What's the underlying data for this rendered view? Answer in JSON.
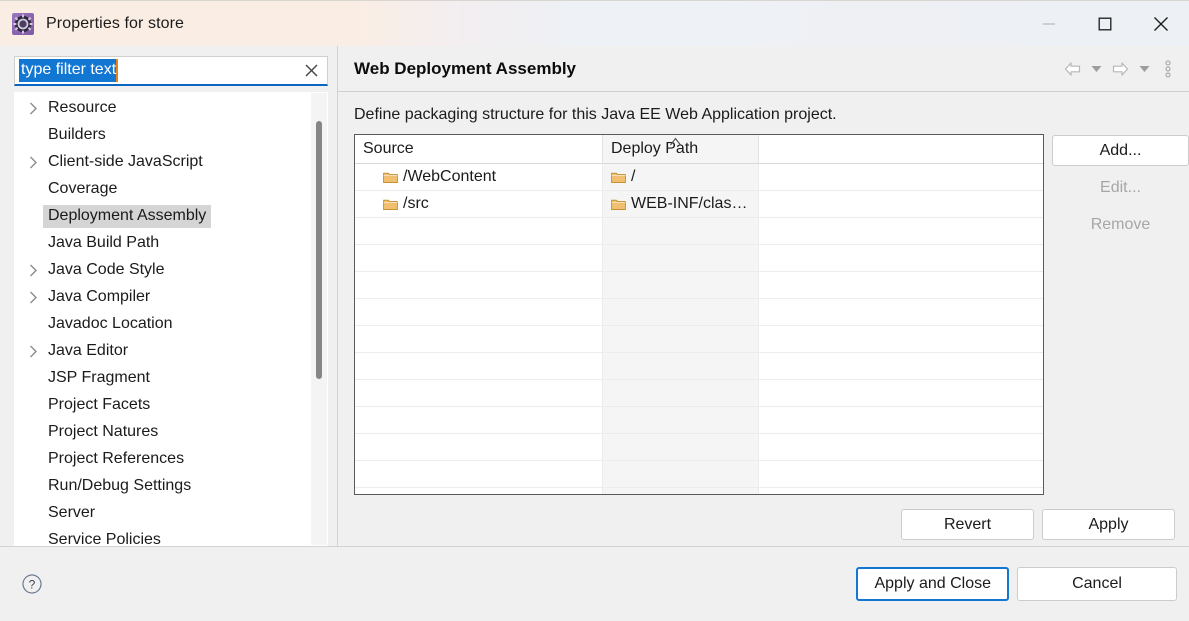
{
  "window": {
    "title": "Properties for store",
    "icon": "properties-gear-icon",
    "controls": {
      "minimize": "minimize-icon",
      "maximize": "maximize-icon",
      "close": "close-icon"
    }
  },
  "sidebar": {
    "filter": {
      "value": "type filter text",
      "placeholder": "type filter text",
      "clear_icon": "clear-icon",
      "selected": true
    },
    "items": [
      {
        "label": "Resource",
        "expandable": true,
        "selected": false
      },
      {
        "label": "Builders",
        "expandable": false,
        "selected": false
      },
      {
        "label": "Client-side JavaScript",
        "expandable": true,
        "selected": false
      },
      {
        "label": "Coverage",
        "expandable": false,
        "selected": false
      },
      {
        "label": "Deployment Assembly",
        "expandable": false,
        "selected": true
      },
      {
        "label": "Java Build Path",
        "expandable": false,
        "selected": false
      },
      {
        "label": "Java Code Style",
        "expandable": true,
        "selected": false
      },
      {
        "label": "Java Compiler",
        "expandable": true,
        "selected": false
      },
      {
        "label": "Javadoc Location",
        "expandable": false,
        "selected": false
      },
      {
        "label": "Java Editor",
        "expandable": true,
        "selected": false
      },
      {
        "label": "JSP Fragment",
        "expandable": false,
        "selected": false
      },
      {
        "label": "Project Facets",
        "expandable": false,
        "selected": false
      },
      {
        "label": "Project Natures",
        "expandable": false,
        "selected": false
      },
      {
        "label": "Project References",
        "expandable": false,
        "selected": false
      },
      {
        "label": "Run/Debug Settings",
        "expandable": false,
        "selected": false
      },
      {
        "label": "Server",
        "expandable": false,
        "selected": false
      },
      {
        "label": "Service Policies",
        "expandable": false,
        "selected": false
      }
    ]
  },
  "page": {
    "title": "Web Deployment Assembly",
    "description": "Define packaging structure for this Java EE Web Application project.",
    "nav": {
      "back_icon": "back-arrow-icon",
      "back_menu_icon": "chevron-down-icon",
      "forward_icon": "forward-arrow-icon",
      "forward_menu_icon": "chevron-down-icon",
      "overflow_icon": "vertical-dots-icon"
    }
  },
  "table": {
    "columns": [
      {
        "label": "Source",
        "sorted": false
      },
      {
        "label": "Deploy Path",
        "sorted": true,
        "sort_direction": "ascending"
      },
      {
        "label": "",
        "sorted": false
      }
    ],
    "rows": [
      {
        "source": "/WebContent",
        "deploy_path": "/",
        "source_icon": "folder-icon",
        "deploy_icon": "folder-icon"
      },
      {
        "source": "/src",
        "deploy_path": "WEB-INF/clas…",
        "source_icon": "folder-icon",
        "deploy_icon": "folder-icon"
      }
    ],
    "empty_row_count": 11
  },
  "side_buttons": [
    {
      "label": "Add...",
      "enabled": true
    },
    {
      "label": "Edit...",
      "enabled": false
    },
    {
      "label": "Remove",
      "enabled": false
    }
  ],
  "apply_buttons": [
    {
      "label": "Revert",
      "enabled": true
    },
    {
      "label": "Apply",
      "enabled": true
    }
  ],
  "footer": {
    "help_icon": "help-icon",
    "buttons": [
      {
        "label": "Apply and Close",
        "default": true
      },
      {
        "label": "Cancel",
        "default": false
      }
    ]
  },
  "colors": {
    "titlebar_left": "#faeee4",
    "titlebar_right": "#edf0f4",
    "accent": "#1277d3",
    "selection": "#1277d3",
    "tree_selection": "#d5d5d5",
    "folder": "#e8b259",
    "panel_bg": "#f0f0f0",
    "sorted_column_bg": "#f5f5f5"
  }
}
